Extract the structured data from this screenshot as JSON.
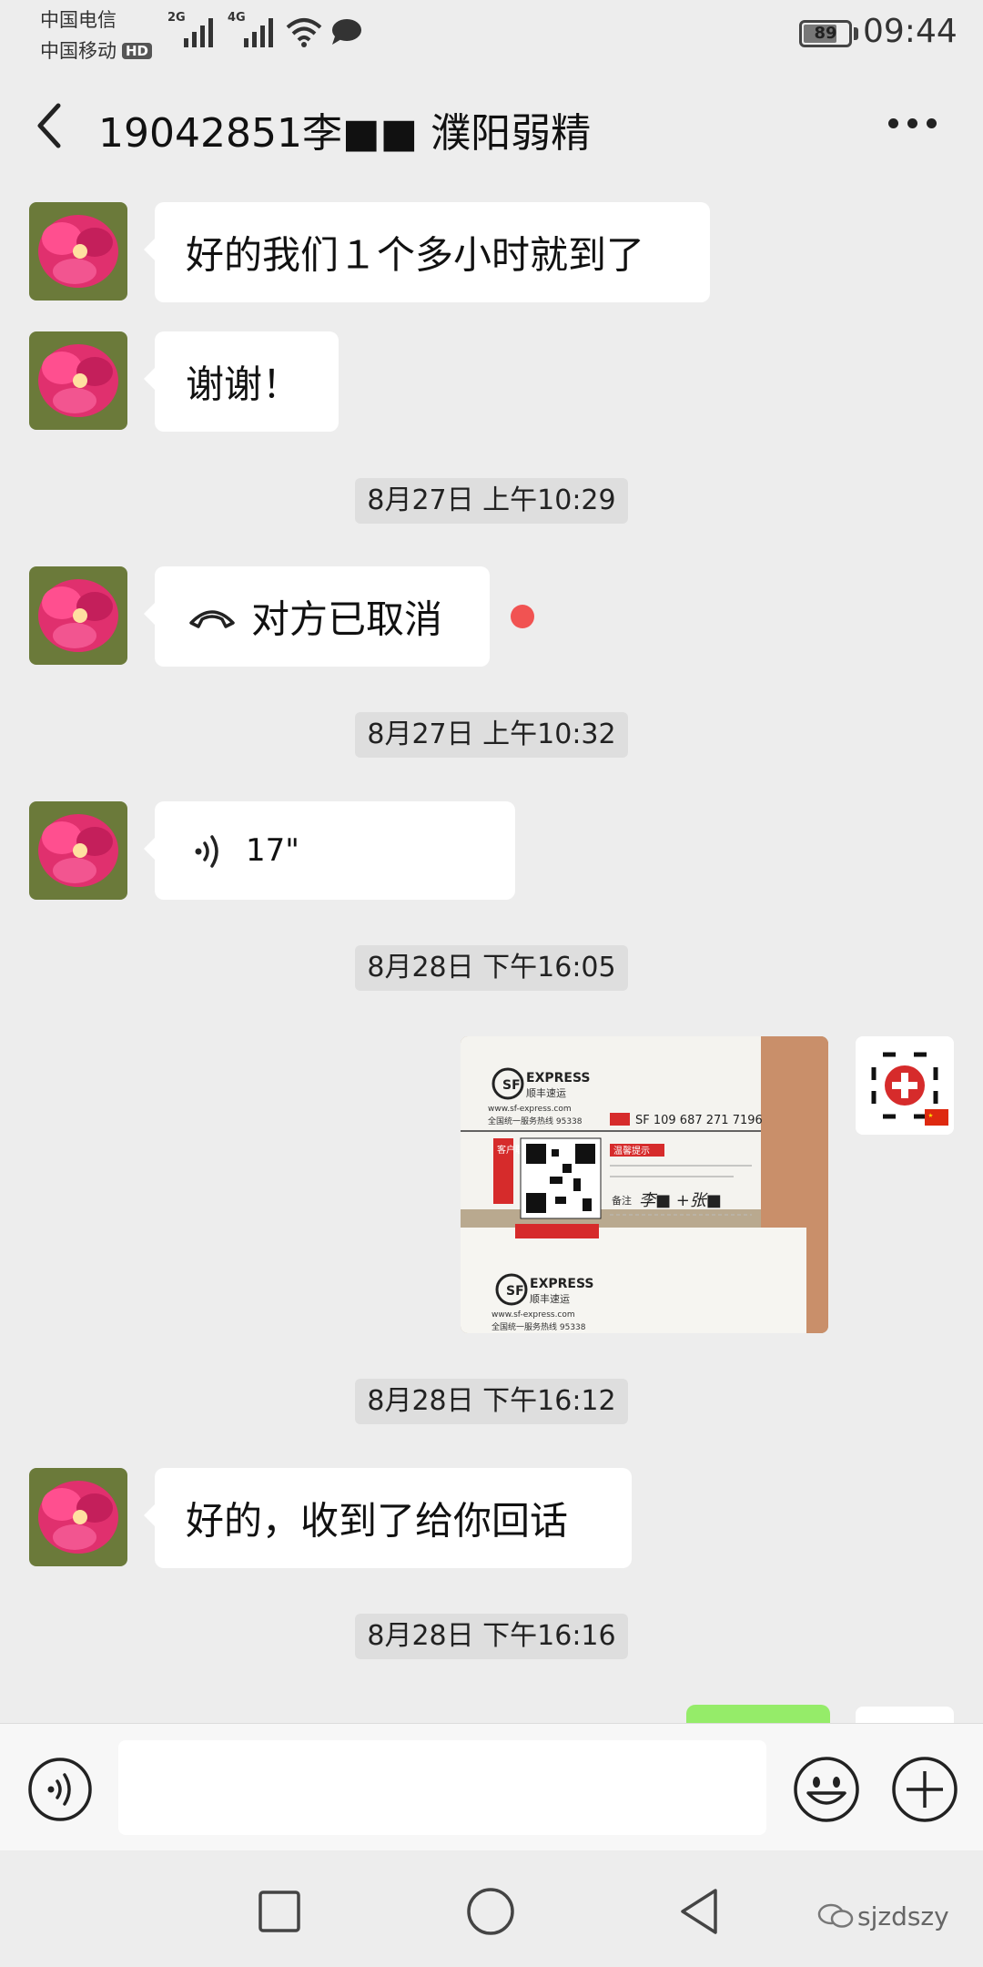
{
  "status_bar": {
    "carrier_1": "中国电信",
    "carrier_2": "中国移动",
    "hd_badge": "HD",
    "signal_1_label": "2G",
    "signal_2_label": "4G",
    "battery": "89",
    "time": "09:44"
  },
  "header": {
    "title": "19042851李■■ 濮阳弱精",
    "back_icon": "chevron-left-icon",
    "more_icon": "more-dots-icon"
  },
  "messages": [
    {
      "type": "text",
      "side": "left",
      "text": "好的我们１个多小时就到了"
    },
    {
      "type": "text",
      "side": "left",
      "text": "谢谢！"
    },
    {
      "type": "time",
      "text": "8月27日 上午10:29"
    },
    {
      "type": "call",
      "side": "left",
      "text": "对方已取消",
      "icon": "phone-hangup-icon",
      "unread": true
    },
    {
      "type": "time",
      "text": "8月27日 上午10:32"
    },
    {
      "type": "voice",
      "side": "left",
      "duration": "17\"",
      "icon": "voice-wave-icon"
    },
    {
      "type": "time",
      "text": "8月28日 下午16:05"
    },
    {
      "type": "image",
      "side": "right",
      "photo_text": {
        "brand": "EXPRESS",
        "brand_cn": "顺丰速运",
        "site": "www.sf-express.com",
        "hotline": "全国统一服务热线 95338",
        "waybill": "SF 109 687 271 7196",
        "note_label": "备注",
        "note_handwriting": "李■ +张■",
        "tag": "客户联",
        "warn": "温馨提示"
      }
    },
    {
      "type": "time",
      "text": "8月28日 下午16:12"
    },
    {
      "type": "text",
      "side": "left",
      "text": "好的，收到了给你回话"
    },
    {
      "type": "time",
      "text": "8月28日 下午16:16"
    }
  ],
  "input_bar": {
    "voice_icon": "voice-mode-icon",
    "input_value": "",
    "emoji_icon": "emoji-icon",
    "plus_icon": "plus-icon"
  },
  "nav_bar": {
    "recent_icon": "recent-apps-icon",
    "home_icon": "home-icon",
    "back_icon": "nav-back-icon",
    "watermark": "sjzdszy"
  },
  "colors": {
    "background": "#ededed",
    "bubble_left": "#ffffff",
    "bubble_right": "#95ec69",
    "unread_dot": "#f15352",
    "timestamp_bg": "#dedede"
  }
}
